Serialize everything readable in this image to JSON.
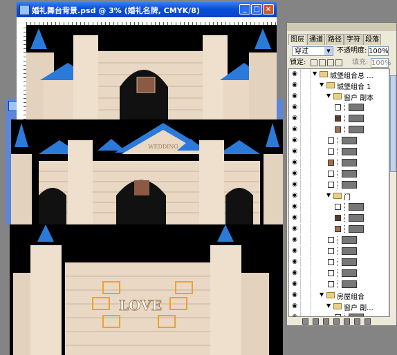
{
  "document_window": {
    "title": "婚礼舞台背景.psd @ 3% (婚礼名牌, CMYK/8)",
    "minimize": "_",
    "maximize": "□",
    "close": "×"
  },
  "canvas": {
    "plaque_text": "WEDDING",
    "love_text": "LOVE"
  },
  "colors": {
    "castle_wall": "#e8d8c4",
    "roof_blue": "#2b7ad9",
    "black_bg": "#000000",
    "frame_orange": "#f0a030",
    "title_blue": "#0a4fd8"
  },
  "layers_panel": {
    "tabs": [
      "图层",
      "通道",
      "路径",
      "字符",
      "段落"
    ],
    "blend_mode": "穿过",
    "opacity_label": "不透明度:",
    "opacity_value": "100%",
    "lock_label": "锁定:",
    "fill_label": "填充:",
    "fill_value": "100%",
    "layers": [
      {
        "name": "城堡组合总 ...",
        "type": "group",
        "indent": 0
      },
      {
        "name": "城堡组合 1",
        "type": "group",
        "indent": 1
      },
      {
        "name": "窗户 副本",
        "type": "group",
        "indent": 2
      },
      {
        "name": "",
        "type": "layer",
        "indent": 3,
        "thumb": "#ffffff"
      },
      {
        "name": "",
        "type": "layer",
        "indent": 3,
        "thumb": "#5a3a2a"
      },
      {
        "name": "",
        "type": "layer",
        "indent": 3,
        "thumb": "#a07050"
      },
      {
        "name": "",
        "type": "layer",
        "indent": 2,
        "thumb": "#ffffff"
      },
      {
        "name": "",
        "type": "layer",
        "indent": 2,
        "thumb": "#ffffff"
      },
      {
        "name": "",
        "type": "layer",
        "indent": 2,
        "thumb": "#a07050"
      },
      {
        "name": "",
        "type": "layer",
        "indent": 2,
        "thumb": "#ffffff"
      },
      {
        "name": "",
        "type": "layer",
        "indent": 2,
        "thumb": "#ffffff"
      },
      {
        "name": "门",
        "type": "group",
        "indent": 2
      },
      {
        "name": "",
        "type": "layer",
        "indent": 3,
        "thumb": "#ffffff"
      },
      {
        "name": "",
        "type": "layer",
        "indent": 3,
        "thumb": "#5a3a2a"
      },
      {
        "name": "",
        "type": "layer",
        "indent": 3,
        "thumb": "#a07050"
      },
      {
        "name": "",
        "type": "layer",
        "indent": 2,
        "thumb": "#ffffff"
      },
      {
        "name": "",
        "type": "layer",
        "indent": 2,
        "thumb": "#ffffff"
      },
      {
        "name": "",
        "type": "layer",
        "indent": 2,
        "thumb": "#ffffff"
      },
      {
        "name": "",
        "type": "layer",
        "indent": 2,
        "thumb": "#ffffff"
      },
      {
        "name": "",
        "type": "layer",
        "indent": 2,
        "thumb": "#ffffff"
      },
      {
        "name": "房屋组合",
        "type": "group",
        "indent": 1
      },
      {
        "name": "窗户 副...",
        "type": "group",
        "indent": 2
      },
      {
        "name": "",
        "type": "layer",
        "indent": 3,
        "thumb": "#ffffff"
      }
    ]
  }
}
